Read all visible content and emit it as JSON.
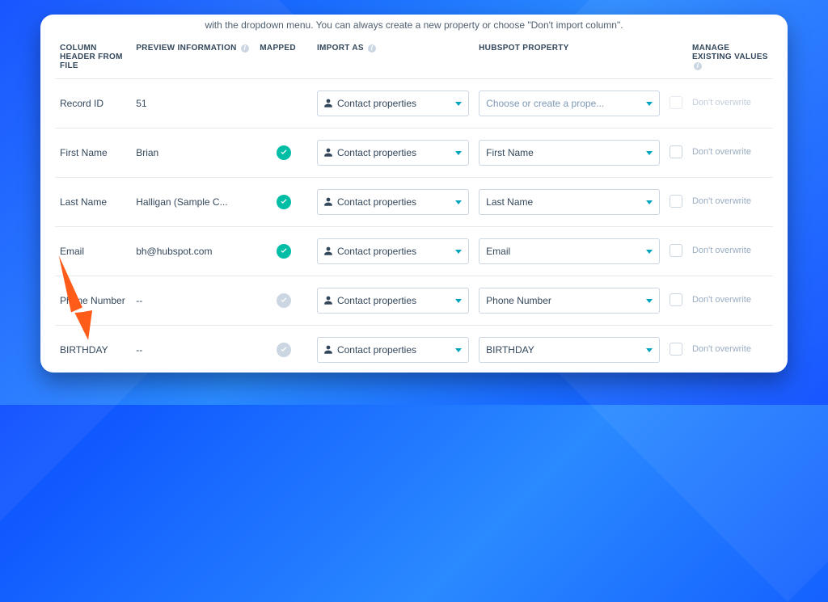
{
  "intro": "with the dropdown menu. You can always create a new property or choose \"Don't import column\".",
  "headers": {
    "column": "COLUMN HEADER FROM FILE",
    "preview": "PREVIEW INFORMATION",
    "mapped": "MAPPED",
    "import_as": "IMPORT AS",
    "hubspot": "HUBSPOT PROPERTY",
    "manage": "MANAGE EXISTING VALUES"
  },
  "import_as_label": "Contact properties",
  "manage_label": "Don't overwrite",
  "rows": [
    {
      "col": "Record ID",
      "preview": "51",
      "mapped": "none",
      "property": "Choose or create a prope...",
      "placeholder": true,
      "mng_disabled": true
    },
    {
      "col": "First Name",
      "preview": "Brian",
      "mapped": "ok",
      "property": "First Name",
      "placeholder": false,
      "mng_disabled": false
    },
    {
      "col": "Last Name",
      "preview": "Halligan (Sample C...",
      "mapped": "ok",
      "property": "Last Name",
      "placeholder": false,
      "mng_disabled": false
    },
    {
      "col": "Email",
      "preview": "bh@hubspot.com",
      "mapped": "ok",
      "property": "Email",
      "placeholder": false,
      "mng_disabled": false
    },
    {
      "col": "Phone Number",
      "preview": "--",
      "mapped": "dim",
      "property": "Phone Number",
      "placeholder": false,
      "mng_disabled": false
    },
    {
      "col": "BIRTHDAY",
      "preview": "--",
      "mapped": "dim",
      "property": "BIRTHDAY",
      "placeholder": false,
      "mng_disabled": false
    }
  ]
}
